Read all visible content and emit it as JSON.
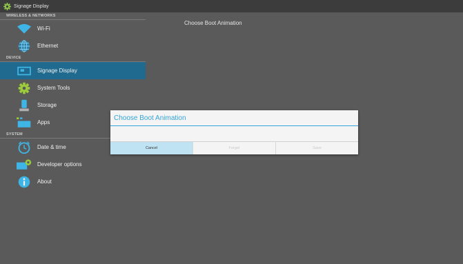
{
  "titlebar": {
    "title": "Signage Display",
    "icon": "gear-icon"
  },
  "sidebar": {
    "sections": [
      {
        "header": "WIRELESS & NETWORKS",
        "items": [
          {
            "label": "Wi-Fi",
            "icon": "wifi-icon"
          },
          {
            "label": "Ethernet",
            "icon": "globe-icon"
          }
        ]
      },
      {
        "header": "DEVICE",
        "items": [
          {
            "label": "Signage Display",
            "icon": "display-icon",
            "selected": true
          },
          {
            "label": "System Tools",
            "icon": "gear-icon"
          },
          {
            "label": "Storage",
            "icon": "storage-icon"
          },
          {
            "label": "Apps",
            "icon": "apps-icon"
          }
        ]
      },
      {
        "header": "SYSTEM",
        "items": [
          {
            "label": "Date & time",
            "icon": "clock-icon"
          },
          {
            "label": "Developer options",
            "icon": "developer-icon"
          },
          {
            "label": "About",
            "icon": "info-icon"
          }
        ]
      }
    ]
  },
  "content": {
    "title": "Choose Boot Animation"
  },
  "dialog": {
    "title": "Choose Boot Animation",
    "buttons": {
      "cancel": "Cancel",
      "forget": "Forget",
      "save": "Save"
    }
  },
  "colors": {
    "accent": "#33a4d8",
    "selected": "#1f6a8e",
    "background": "#5a5a5a"
  }
}
